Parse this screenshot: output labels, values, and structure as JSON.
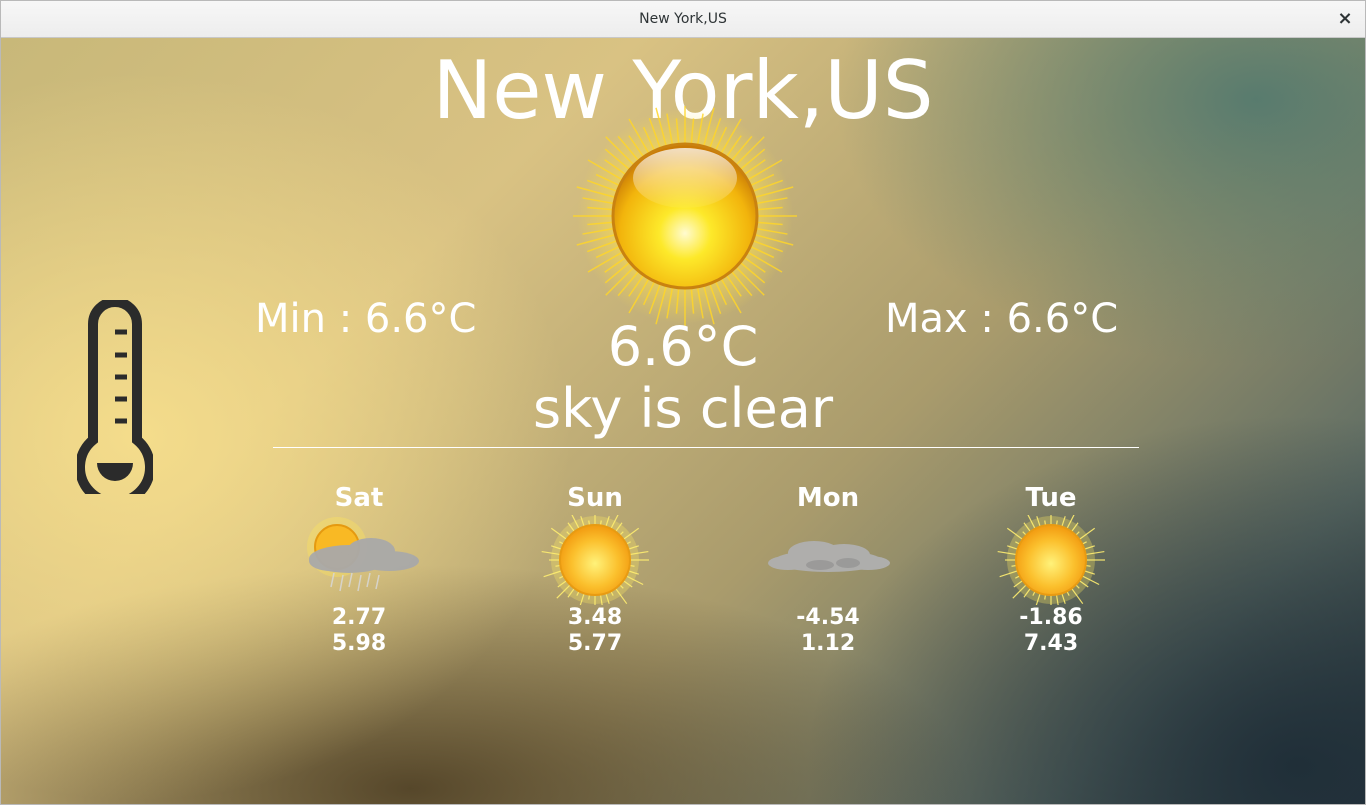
{
  "window": {
    "title": "New York,US",
    "close_label": "×"
  },
  "current": {
    "city": "New York,US",
    "min": "Min : 6.6°C",
    "max": "Max : 6.6°C",
    "temperature": "6.6°C",
    "description": "sky is clear",
    "icon": "sun-icon"
  },
  "forecast": [
    {
      "day": "Sat",
      "icon": "sun-behind-rain-cloud-icon",
      "low": "2.77",
      "high": "5.98"
    },
    {
      "day": "Sun",
      "icon": "sun-icon",
      "low": "3.48",
      "high": "5.77"
    },
    {
      "day": "Mon",
      "icon": "cloud-icon",
      "low": "-4.54",
      "high": "1.12"
    },
    {
      "day": "Tue",
      "icon": "sun-icon",
      "low": "-1.86",
      "high": "7.43"
    }
  ],
  "colors": {
    "text": "#ffffff",
    "thermometer": "#2b2b2b",
    "sun": "#f7c51c"
  }
}
